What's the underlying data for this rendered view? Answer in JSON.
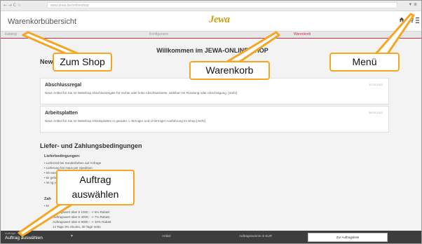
{
  "browser": {
    "nav_glyphs": "← → C ☆",
    "url": "www.jewa.de/onlineshop",
    "ext_glyph": "▼ ⊕"
  },
  "header": {
    "title": "Warenkorbübersicht",
    "logo": "Jewa",
    "icons": [
      "home-icon",
      "cart-icon",
      "menu-icon"
    ]
  },
  "steps": {
    "items": [
      "Katalog",
      "Konfigurator",
      "Warenkorb"
    ],
    "active_index": 2
  },
  "content": {
    "welcome": "Willkommen im JEWA-ONLINE-SHOP",
    "news_heading": "New",
    "news": [
      {
        "title": "Abschlussregal",
        "date": "12.03.2021",
        "text": "Neue Artikel für Sie im Webshop Abschlussregale für rechte oder linke Abschlussseite, wählbar mit Rundung oder Abschrägung. [mehr]"
      },
      {
        "title": "Arbeitsplatten",
        "date": "08.03.2021",
        "text": "Neue Artikel für Sie im Webshop Arbeitsplatten in gerader, L-förmiger und U-förmiger Ausführung im Shop [mehr]"
      }
    ],
    "terms_heading": "Liefer- und Zahlungsbedingungen",
    "delivery_heading": "Lieferbedingungen:",
    "delivery_lines": [
      "• Lieferzeit bei Sonderfarben auf Anfrage",
      "• Lieferung frei Haus per Spedition",
      "• Mi                                                        ransportkosten auf Euro-Palette (im Preis inkludiert)",
      "• Br                                                        geliefert",
      "• W                                                          ng vom Shopartikel"
    ],
    "payment_heading": "Zah",
    "payment_lines": [
      "• M",
      "Auftragswert über € 1000,-  -> 5%  Rabatt",
      "Auftragswert über € 4000,-  -> 7%  Rabatt",
      "Auftragswert über € 8000,-  -> 10% Rabatt",
      "                                                    14 Tage 3% Skonto, 30 Tage netto"
    ]
  },
  "bottom_bar": {
    "label": "Aufträge",
    "value": "Auftrag auswählen",
    "chevron": "▾",
    "col_article": "Artikel",
    "col_sum": "Auftragssumme in EUR",
    "button": "Zur Auftragsliste"
  },
  "callouts": {
    "shop": "Zum Shop",
    "cart": "Warenkorb",
    "menu": "Menü",
    "order_line1": "Auftrag",
    "order_line2": "auswählen"
  },
  "colors": {
    "accent": "#c8314a",
    "callout_border": "#f5a623",
    "logo": "#d4a017",
    "bottom_bar": "#3d3d3d"
  }
}
